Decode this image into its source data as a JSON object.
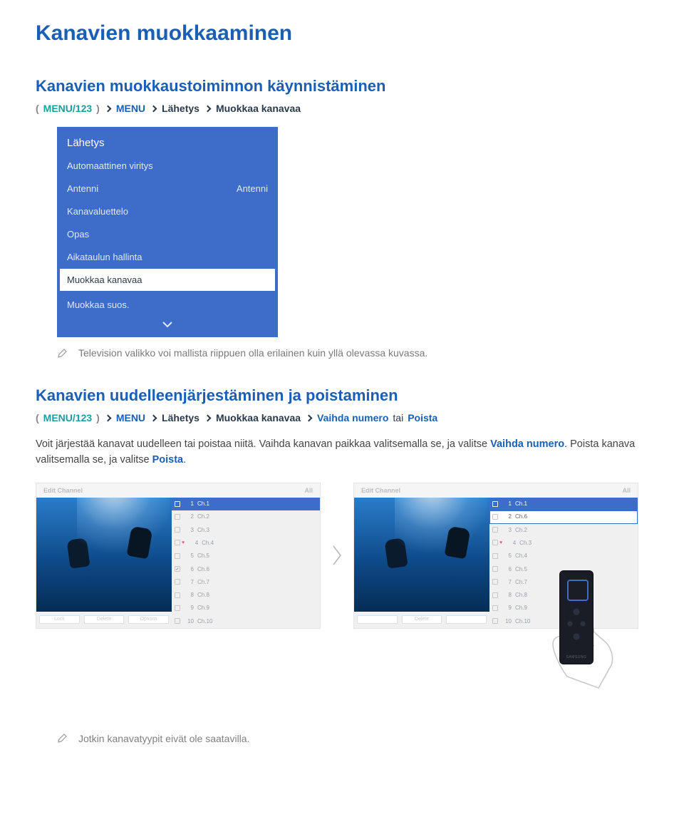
{
  "title": "Kanavien muokkaaminen",
  "section1": {
    "heading": "Kanavien muokkaustoiminnon käynnistäminen",
    "breadcrumb": {
      "open": "(",
      "m1": "MENU/123",
      "close": ")",
      "menu": "MENU",
      "p1": "Lähetys",
      "p2": "Muokkaa kanavaa"
    },
    "panel": {
      "title": "Lähetys",
      "items": {
        "a": "Automaattinen viritys",
        "b_label": "Antenni",
        "b_value": "Antenni",
        "c": "Kanavaluettelo",
        "d": "Opas",
        "e": "Aikataulun hallinta",
        "f": "Muokkaa kanavaa",
        "g": "Muokkaa suos."
      }
    },
    "note": "Television valikko voi mallista riippuen olla erilainen kuin yllä olevassa kuvassa."
  },
  "section2": {
    "heading": "Kanavien uudelleenjärjestäminen ja poistaminen",
    "breadcrumb": {
      "open": "(",
      "m1": "MENU/123",
      "close": ")",
      "menu": "MENU",
      "p1": "Lähetys",
      "p2": "Muokkaa kanavaa",
      "p3a": "Vaihda numero",
      "tai": "tai",
      "p3b": "Poista"
    },
    "body": {
      "t1": "Voit järjestää kanavat uudelleen tai poistaa niitä. Vaihda kanavan paikkaa valitsemalla se, ja valitse ",
      "link1": "Vaihda numero",
      "t2": ". Poista kanava valitsemalla se, ja valitse ",
      "link2": "Poista",
      "t3": "."
    },
    "screenA": {
      "hd_left": "Edit Channel",
      "hd_right": "All",
      "btn1": "Lock",
      "btn2": "Delete",
      "btn3": "Options",
      "rows": [
        {
          "n": "1",
          "name": "Ch.1",
          "sel": true,
          "chk": false,
          "fav": false
        },
        {
          "n": "2",
          "name": "Ch.2",
          "sel": false,
          "chk": false,
          "fav": false
        },
        {
          "n": "3",
          "name": "Ch.3",
          "sel": false,
          "chk": false,
          "fav": false
        },
        {
          "n": "4",
          "name": "Ch.4",
          "sel": false,
          "chk": false,
          "fav": true
        },
        {
          "n": "5",
          "name": "Ch.5",
          "sel": false,
          "chk": false,
          "fav": false
        },
        {
          "n": "6",
          "name": "Ch.6",
          "sel": false,
          "chk": true,
          "fav": false
        },
        {
          "n": "7",
          "name": "Ch.7",
          "sel": false,
          "chk": false,
          "fav": false
        },
        {
          "n": "8",
          "name": "Ch.8",
          "sel": false,
          "chk": false,
          "fav": false
        },
        {
          "n": "9",
          "name": "Ch.9",
          "sel": false,
          "chk": false,
          "fav": false
        },
        {
          "n": "10",
          "name": "Ch.10",
          "sel": false,
          "chk": false,
          "fav": false
        }
      ]
    },
    "screenB": {
      "hd_left": "Edit Channel",
      "hd_right": "All",
      "btn2": "Delete",
      "rows": [
        {
          "n": "1",
          "name": "Ch.1",
          "sel": true,
          "chk": false,
          "fav": false,
          "boxed": false
        },
        {
          "n": "2",
          "name": "Ch.6",
          "sel": false,
          "chk": false,
          "fav": false,
          "boxed": true
        },
        {
          "n": "3",
          "name": "Ch.2",
          "sel": false,
          "chk": false,
          "fav": false,
          "boxed": false
        },
        {
          "n": "4",
          "name": "Ch.3",
          "sel": false,
          "chk": false,
          "fav": true,
          "boxed": false
        },
        {
          "n": "5",
          "name": "Ch.4",
          "sel": false,
          "chk": false,
          "fav": false,
          "boxed": false
        },
        {
          "n": "6",
          "name": "Ch.5",
          "sel": false,
          "chk": false,
          "fav": false,
          "boxed": false
        },
        {
          "n": "7",
          "name": "Ch.7",
          "sel": false,
          "chk": false,
          "fav": false,
          "boxed": false
        },
        {
          "n": "8",
          "name": "Ch.8",
          "sel": false,
          "chk": false,
          "fav": false,
          "boxed": false
        },
        {
          "n": "9",
          "name": "Ch.9",
          "sel": false,
          "chk": false,
          "fav": false,
          "boxed": false
        },
        {
          "n": "10",
          "name": "Ch.10",
          "sel": false,
          "chk": false,
          "fav": false,
          "boxed": false
        }
      ]
    },
    "remote_brand": "SAMSUNG"
  },
  "footnote": "Jotkin kanavatyypit eivät ole saatavilla."
}
